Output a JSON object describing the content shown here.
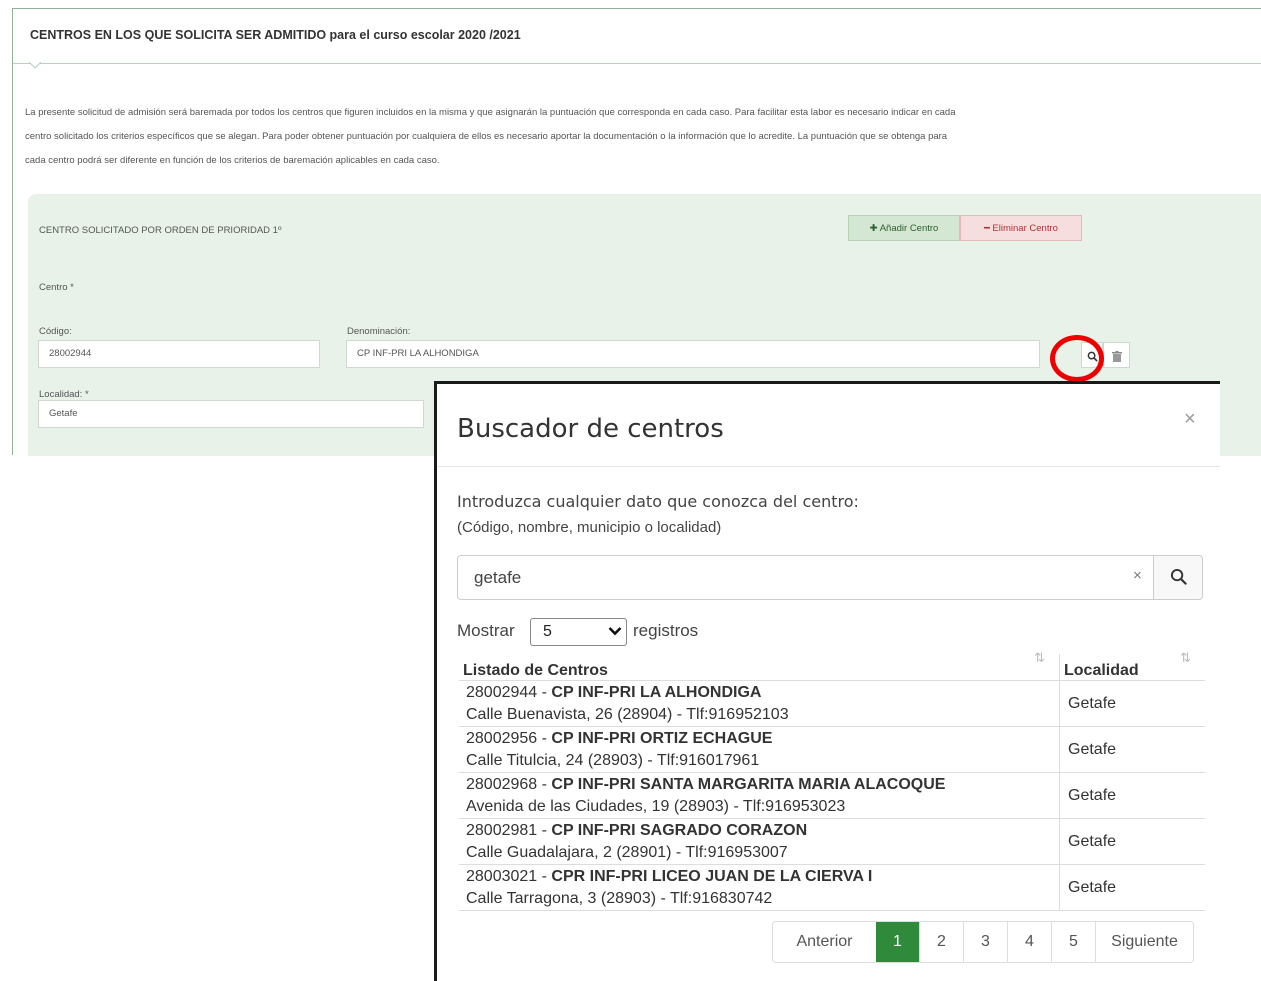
{
  "form": {
    "title_upper": "CENTROS EN LOS QUE SOLICITA SER ADMITIDO",
    "title_rest": " para el curso escolar 2020 /2021",
    "intro_lines": [
      "La presente solicitud de admisión será baremada por todos los centros que figuren incluidos en la misma y que asignarán la puntuación que corresponda en cada caso. Para facilitar esta labor es necesario indicar en cada",
      "centro solicitado los criterios específicos que se alegan. Para poder obtener puntuación por cualquiera de ellos es necesario aportar la documentación o la información que lo acredite. La puntuación que se obtenga para",
      "cada centro podrá ser diferente en función de los criterios de baremación aplicables en cada caso."
    ],
    "centro_heading": "CENTRO SOLICITADO POR ORDEN DE PRIORIDAD 1º",
    "add_label": "✚ Añadir Centro",
    "remove_label": "━ Eliminar Centro",
    "centro_label": "Centro *",
    "codigo_label": "Código:",
    "codigo_value": "28002944",
    "denominacion_label": "Denominación:",
    "denominacion_value": "CP INF-PRI LA ALHONDIGA",
    "localidad_label": "Localidad: *",
    "localidad_value": "Getafe"
  },
  "modal": {
    "title": "Buscador de centros",
    "close_glyph": "×",
    "instruction": "Introduzca cualquier dato que conozca del centro:",
    "hint": "(Código, nombre, municipio o localidad)",
    "search_value": "getafe",
    "clear_glyph": "×",
    "length_label": "Mostrar",
    "length_value": "5",
    "length_suffix": "registros",
    "columns": [
      "Listado de Centros",
      "Localidad"
    ],
    "rows": [
      {
        "code": "28002944",
        "name": "CP INF-PRI LA ALHONDIGA",
        "address": "Calle Buenavista, 26 (28904) - Tlf:916952103",
        "localidad": "Getafe"
      },
      {
        "code": "28002956",
        "name": "CP INF-PRI ORTIZ ECHAGUE",
        "address": "Calle Titulcia, 24 (28903) - Tlf:916017961",
        "localidad": "Getafe"
      },
      {
        "code": "28002968",
        "name": "CP INF-PRI SANTA MARGARITA MARIA ALACOQUE",
        "address": "Avenida de las Ciudades, 19 (28903) - Tlf:916953023",
        "localidad": "Getafe"
      },
      {
        "code": "28002981",
        "name": "CP INF-PRI SAGRADO CORAZON",
        "address": "Calle Guadalajara, 2 (28901) - Tlf:916953007",
        "localidad": "Getafe"
      },
      {
        "code": "28003021",
        "name": "CPR INF-PRI LICEO JUAN DE LA CIERVA I",
        "address": "Calle Tarragona, 3 (28903) - Tlf:916830742",
        "localidad": "Getafe"
      }
    ],
    "pagination": {
      "prev": "Anterior",
      "pages": [
        "1",
        "2",
        "3",
        "4",
        "5"
      ],
      "active": "1",
      "next": "Siguiente"
    }
  },
  "colors": {
    "accent_green": "#2f8a3c",
    "highlight_circle": "#ee0000",
    "centro_box_bg": "#e8f2e8"
  },
  "icons": {
    "search": "magnifier-icon",
    "trash": "trash-icon",
    "sort": "sort-icon",
    "chevron": "chevron-down-icon"
  }
}
